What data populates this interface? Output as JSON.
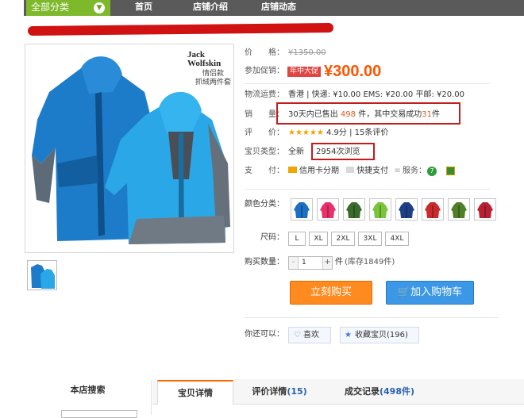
{
  "nav": {
    "all_categories": "全部分类",
    "home": "首页",
    "shop_intro": "店铺介绍",
    "shop_news": "店铺动态"
  },
  "product": {
    "brand_line1": "Jack",
    "brand_line2": "Wolfskin",
    "image_caption1": "情侣款",
    "image_caption2": "抓绒两件套"
  },
  "price": {
    "label": "价　　格：",
    "original": "¥1350.00",
    "promo_label": "参加促销：",
    "promo_badge": "年中大促",
    "promo_price": "¥300.00"
  },
  "shipping": {
    "label": "物流运费：",
    "text": "香港 | 快递: ¥10.00  EMS: ¥20.00  平邮: ¥20.00"
  },
  "sales": {
    "label": "销　　量：",
    "prefix": "30天内已售出",
    "count": "498",
    "middle": "件，其中交易成功",
    "success": "31",
    "suffix": "件"
  },
  "rating": {
    "label": "评　　价：",
    "stars": "★★★★★",
    "score": "4.9分",
    "reviews": "15条评价"
  },
  "item_type": {
    "label": "宝贝类型：",
    "value": "全新",
    "views": "2954次浏览"
  },
  "payment": {
    "label": "支　　付：",
    "credit": "信用卡分期",
    "quick": "快捷支付",
    "service_label": "服务："
  },
  "color": {
    "label": "颜色分类：",
    "options": [
      "#1c6fc2",
      "#e8306c",
      "#3a6b2c",
      "#79c53a",
      "#1e3f86",
      "#c82b2b",
      "#4f7f28",
      "#b81f33"
    ]
  },
  "size": {
    "label": "尺码：",
    "options": [
      "L",
      "XL",
      "2XL",
      "3XL",
      "4XL"
    ]
  },
  "quantity": {
    "label": "购买数量：",
    "value": "1",
    "unit": "件",
    "stock": "(库存1849件)"
  },
  "actions": {
    "buy_now": "立刻购买",
    "add_to_cart": "加入购物车",
    "also_label": "你还可以：",
    "like": "喜欢",
    "favorite": "收藏宝贝",
    "favorite_count": "(196)"
  },
  "bottom": {
    "shop_search": "本店搜索",
    "tab_details": "宝贝详情",
    "tab_reviews": "评价详情",
    "tab_reviews_count": "(15)",
    "tab_records": "成交记录",
    "tab_records_count": "(498件)"
  },
  "colors": {
    "nav_bg": "#5a5a5a",
    "accent_green": "#7eb92c",
    "price_orange": "#ff5400",
    "buy_orange": "#ff8a1f",
    "cart_blue": "#3c98e6",
    "highlight_red": "#c41b1b"
  }
}
